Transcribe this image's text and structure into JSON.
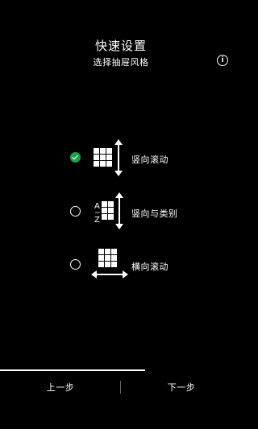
{
  "header": {
    "title": "快速设置",
    "subtitle": "选择抽屉风格",
    "info_icon": "info-icon"
  },
  "options": [
    {
      "label": "竖向滚动",
      "selected": true,
      "icon": "vertical-scroll-grid-icon"
    },
    {
      "label": "竖向与类别",
      "selected": false,
      "icon": "vertical-alphabetical-grid-icon",
      "icon_letters": [
        "A",
        "~",
        "Z"
      ]
    },
    {
      "label": "横向滚动",
      "selected": false,
      "icon": "horizontal-scroll-grid-icon"
    }
  ],
  "footer": {
    "prev_label": "上一步",
    "next_label": "下一步"
  },
  "colors": {
    "background": "#000000",
    "text": "#ffffff",
    "selected_radio": "#1aa34a"
  }
}
